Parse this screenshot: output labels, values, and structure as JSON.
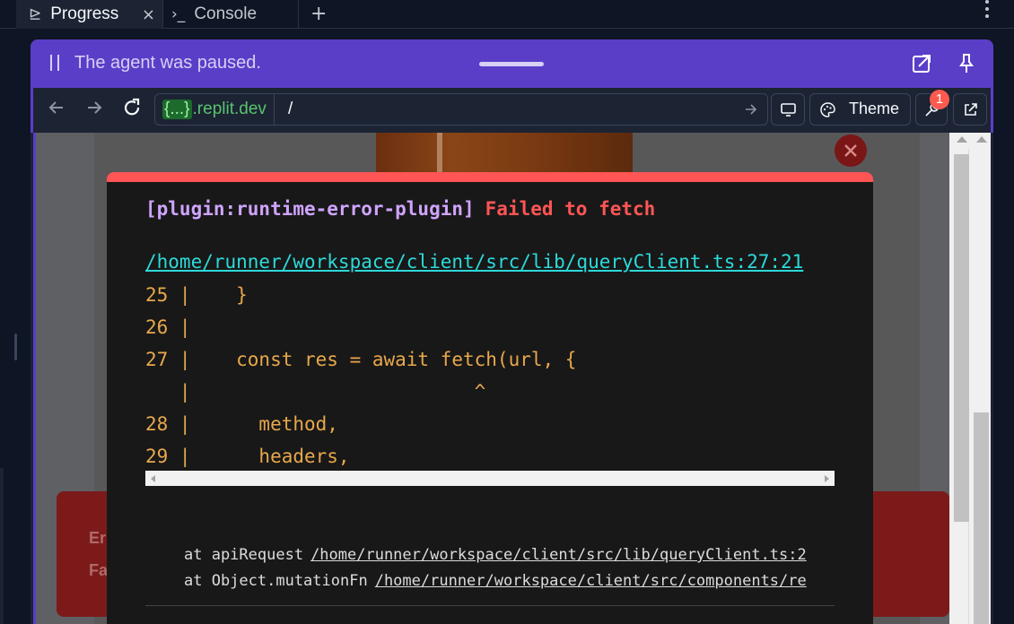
{
  "tabs": [
    {
      "label": "Progress",
      "icon": "progress-icon",
      "active": true,
      "close": "×"
    },
    {
      "label": "Console",
      "icon": "console-icon",
      "active": false
    }
  ],
  "tab_icons": {
    "progress": "⊵",
    "console": "›_",
    "add": "+"
  },
  "pause_bar": {
    "text": "The agent was paused.",
    "color": "#5a3ec8"
  },
  "address_bar": {
    "host_brace": "{...}",
    "host_domain": ".replit.dev",
    "path": "/",
    "theme_label": "Theme",
    "devtools_badge": "1"
  },
  "error_overlay": {
    "plugin": "[plugin:runtime-error-plugin]",
    "message": "Failed to fetch",
    "file": "/home/runner/workspace/client/src/lib/queryClient.ts:27:21",
    "code_lines": [
      "25 |    }",
      "26 |",
      "27 |    const res = await fetch(url, {",
      "   |                         ^",
      "28 |      method,",
      "29 |      headers,"
    ],
    "stack": [
      {
        "text": "at apiRequest",
        "file": "/home/runner/workspace/client/src/lib/queryClient.ts:2"
      },
      {
        "text": "at Object.mutationFn",
        "file": "/home/runner/workspace/client/src/components/re"
      }
    ],
    "accent": "#ff5555"
  },
  "background_alert": {
    "line1": "Er",
    "line2": "Fa"
  }
}
